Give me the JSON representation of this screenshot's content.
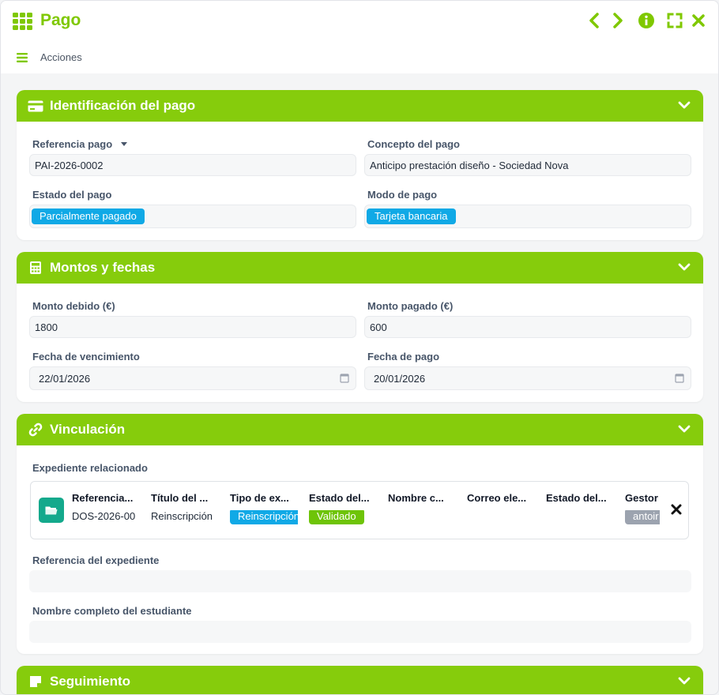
{
  "window": {
    "title": "Pago",
    "actions_label": "Acciones",
    "accent_color": "#86cc0c",
    "controls": [
      "chevron-left-icon",
      "chevron-right-icon",
      "info-icon",
      "fullscreen-icon",
      "close-icon"
    ]
  },
  "sections": {
    "identificacion": {
      "title": "Identificación del pago",
      "referencia_label": "Referencia pago",
      "referencia_value": "PAI-2026-0002",
      "concepto_label": "Concepto del pago",
      "concepto_value": "Anticipo prestación diseño - Sociedad Nova",
      "estado_label": "Estado del pago",
      "estado_value": "Parcialmente pagado",
      "modo_label": "Modo de pago",
      "modo_value": "Tarjeta bancaria"
    },
    "montos": {
      "title": "Montos y fechas",
      "debido_label": "Monto debido (€)",
      "debido_value": "1800",
      "pagado_label": "Monto pagado (€)",
      "pagado_value": "600",
      "vencimiento_label": "Fecha de vencimiento",
      "vencimiento_value": "22/01/2026",
      "fecha_pago_label": "Fecha de pago",
      "fecha_pago_value": "20/01/2026"
    },
    "vinculacion": {
      "title": "Vinculación",
      "expediente_label": "Expediente relacionado",
      "columns": [
        {
          "header": "Referencia...",
          "value": "DOS-2026-00",
          "kind": "text"
        },
        {
          "header": "Título del ...",
          "value": "Reinscripción",
          "kind": "text"
        },
        {
          "header": "Tipo de ex...",
          "value": "Reinscripción",
          "kind": "tag-blue"
        },
        {
          "header": "Estado del...",
          "value": "Validado",
          "kind": "tag-green"
        },
        {
          "header": "Nombre c...",
          "value": "",
          "kind": "text"
        },
        {
          "header": "Correo ele...",
          "value": "",
          "kind": "text"
        },
        {
          "header": "Estado del...",
          "value": "",
          "kind": "text"
        },
        {
          "header": "Gestor",
          "value": "antoir",
          "kind": "tag-gray"
        }
      ],
      "ref_expediente_label": "Referencia del expediente",
      "ref_expediente_value": "",
      "nombre_estudiante_label": "Nombre completo del estudiante",
      "nombre_estudiante_value": ""
    },
    "seguimiento": {
      "title": "Seguimiento"
    }
  }
}
